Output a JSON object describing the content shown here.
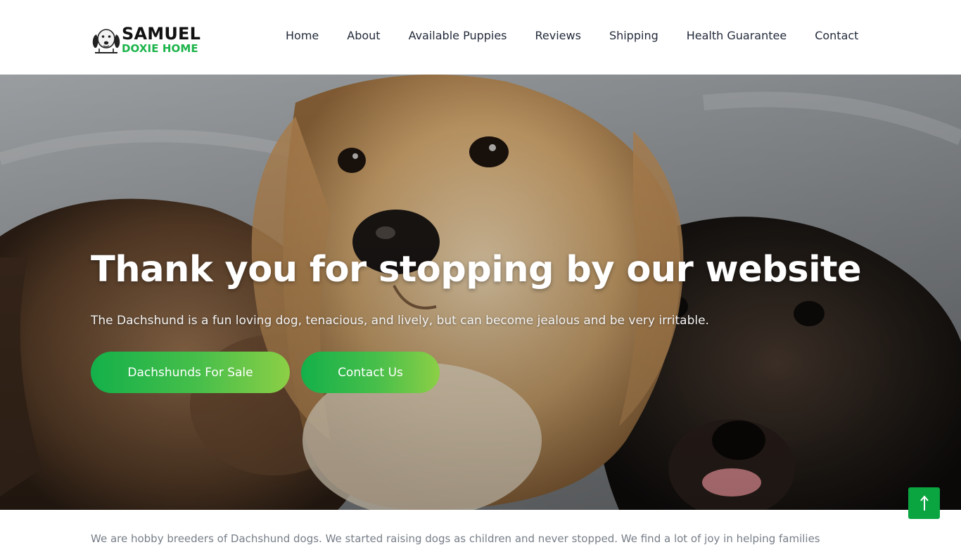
{
  "brand": {
    "line1": "SAMUEL",
    "line2": "DOXIE HOME",
    "accent_color": "#1bb34a"
  },
  "nav": {
    "items": [
      {
        "label": "Home"
      },
      {
        "label": "About"
      },
      {
        "label": "Available Puppies"
      },
      {
        "label": "Reviews"
      },
      {
        "label": "Shipping"
      },
      {
        "label": "Health Guarantee"
      },
      {
        "label": "Contact"
      }
    ]
  },
  "hero": {
    "title": "Thank you for stopping by our website",
    "subtitle": "The Dachshund is a fun loving dog, tenacious, and lively, but can become jealous and be very irritable.",
    "primary_button": "Dachshunds For Sale",
    "secondary_button": "Contact Us",
    "button_gradient": [
      "#14b04a",
      "#8ccf46"
    ]
  },
  "intro": {
    "text": "We are hobby breeders of Dachshund dogs. We started raising dogs as children and never stopped. We find a lot of joy in helping families"
  },
  "icons": {
    "back_to_top": "arrow-up-icon",
    "logo": "dachshund-logo-icon"
  }
}
